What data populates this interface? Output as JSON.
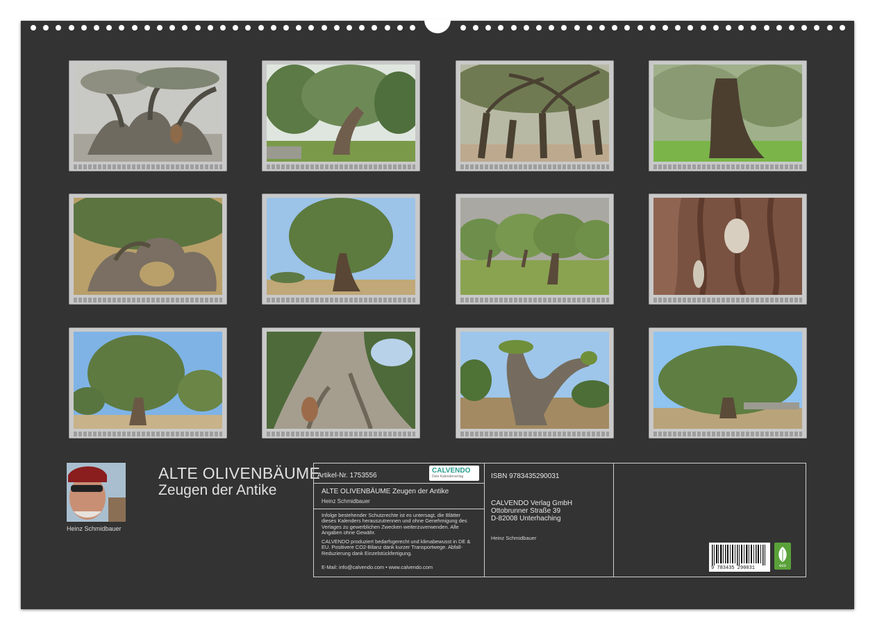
{
  "calendar": {
    "title": "ALTE OLIVENBÄUME",
    "subtitle": "Zeugen der Antike",
    "author": "Heinz Schmidbauer",
    "photo_count": 12
  },
  "imprint": {
    "article_label": "Artikel-Nr. 1753556",
    "publisher_logo": "CALVENDO",
    "logo_tagline": "Dein Kalenderverlag",
    "product_title": "ALTE OLIVENBÄUME Zeugen der Antike",
    "product_author": "Heinz Schmidbauer",
    "legal_text": "Infolge bestehender Schutzrechte ist es untersagt, die Blätter dieses Kalenders herauszutrennen und ohne Genehmigung des Verlages zu gewerblichen Zwecken weiterzuverwenden. Alle Angaben ohne Gewähr.",
    "eco_text": "CALVENDO produziert bedarfsgerecht und klimabewusst in DE & EU. Positivere CO2-Bilanz dank kurzer Transportwege. Abfall-Reduzierung dank Einzelstückfertigung.",
    "contact": "E-Mail: info@calvendo.com • www.calvendo.com",
    "isbn": "ISBN 9783435290031",
    "publisher_name": "CALVENDO Verlag GmbH",
    "publisher_street": "Ottobrunner Straße 39",
    "publisher_city": "D-82008 Unterhaching",
    "publisher_author": "Heinz Schmidbauer",
    "barcode_digits": "9 783435 290031",
    "eco_badge": "eco"
  },
  "colors": {
    "page_background": "#333333",
    "frame": "#c9c9c9",
    "text": "#e0e0e0",
    "logo_accent": "#2a9d8f",
    "eco_green": "#5aa13a"
  }
}
